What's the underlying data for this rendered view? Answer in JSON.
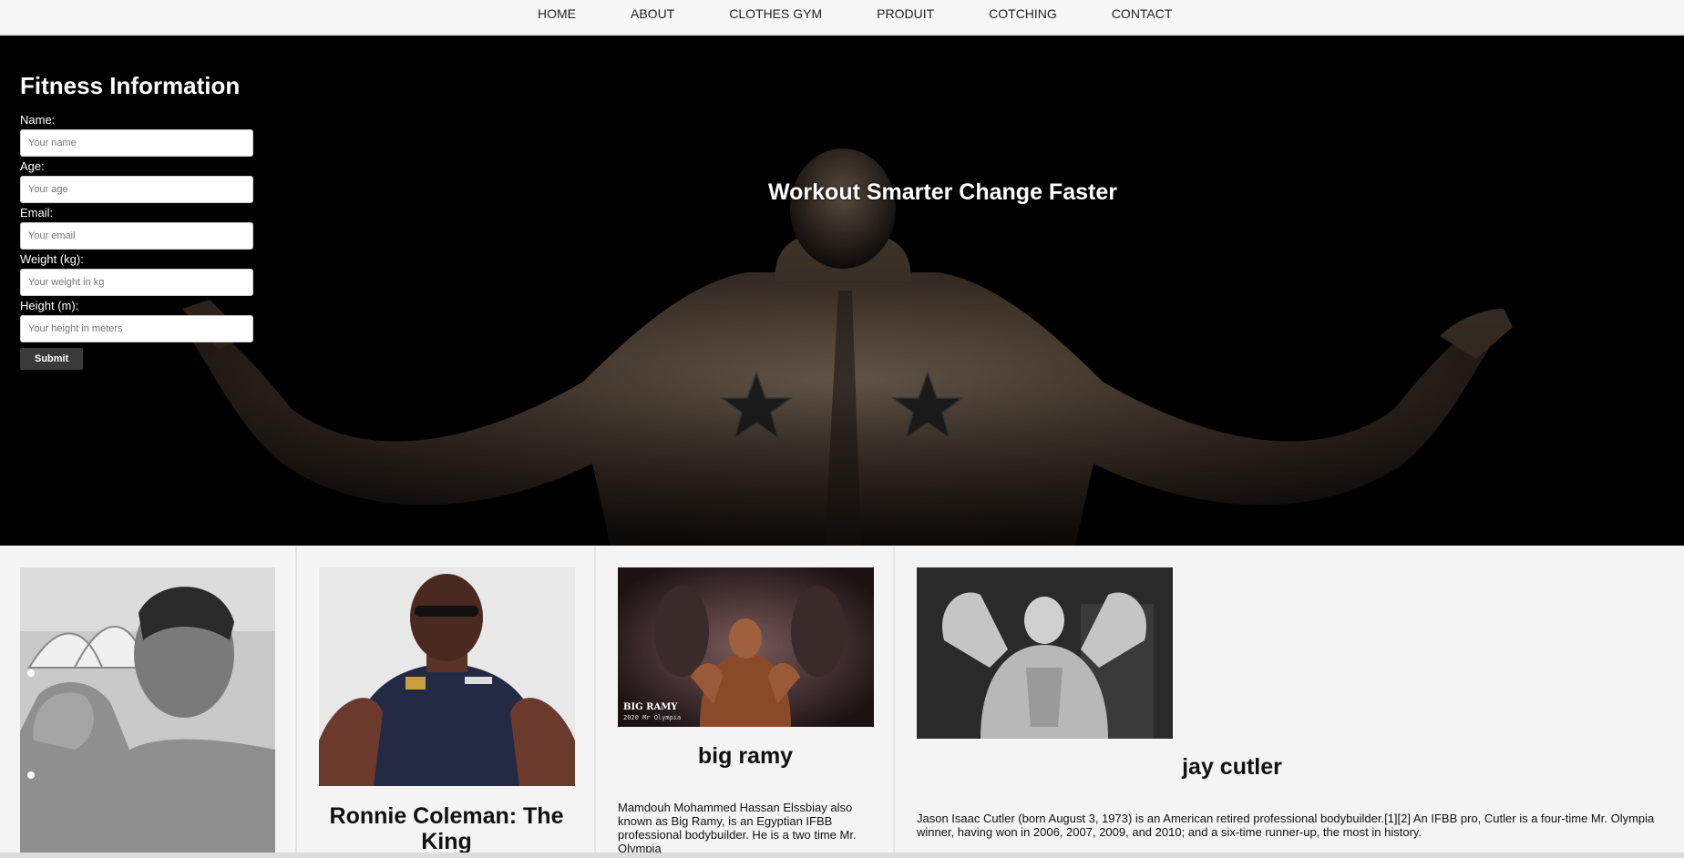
{
  "nav": {
    "items": [
      "HOME",
      "ABOUT",
      "CLOTHES GYM",
      "PRODUIT",
      "COTCHING",
      "CONTACT"
    ]
  },
  "form": {
    "title": "Fitness Information",
    "fields": [
      {
        "label": "Name:",
        "placeholder": "Your name"
      },
      {
        "label": "Age:",
        "placeholder": "Your age"
      },
      {
        "label": "Email:",
        "placeholder": "Your email"
      },
      {
        "label": "Weight (kg):",
        "placeholder": "Your weight in kg"
      },
      {
        "label": "Height (m):",
        "placeholder": "Your height in meters"
      }
    ],
    "submit_label": "Submit"
  },
  "hero": {
    "tagline": "Workout Smarter Change Faster"
  },
  "cards": [
    {
      "title": "",
      "text": ""
    },
    {
      "title": "Ronnie Coleman: The King",
      "text": ""
    },
    {
      "title": "big ramy",
      "text": "Mamdouh Mohammed Hassan Elssbiay also known as Big Ramy, is an Egyptian IFBB professional bodybuilder. He is a two time Mr. Olympia",
      "photo_caption": "BIG RAMY",
      "photo_subcaption": "2020 Mr Olympia"
    },
    {
      "title": "jay cutler",
      "text": "Jason Isaac Cutler (born August 3, 1973) is an American retired professional bodybuilder.[1][2] An IFBB pro, Cutler is a four-time Mr. Olympia winner, having won in 2006, 2007, 2009, and 2010; and a six-time runner-up, the most in history."
    }
  ],
  "colors": {
    "hero_bg": "#000000",
    "nav_bg": "#f7f7f7",
    "page_bg": "#f4f4f4",
    "button_bg": "#3a3a3a"
  }
}
